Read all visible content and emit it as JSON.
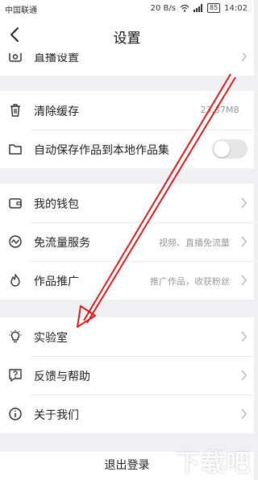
{
  "status_bar": {
    "carrier": "中国联通",
    "speed": "20 B/s",
    "battery": "85",
    "time": "14:02"
  },
  "nav": {
    "title": "设置"
  },
  "rows": {
    "live_settings": "直播设置",
    "clear_cache": "清除缓存",
    "cache_size": "23.37MB",
    "auto_save": "自动保存作品到本地作品集",
    "wallet": "我的钱包",
    "free_data": "免流量服务",
    "free_data_desc": "视频、直播免流量",
    "promotion": "作品推广",
    "promotion_desc": "推广作品，收获粉丝",
    "lab": "实验室",
    "feedback": "反馈与帮助",
    "about": "关于我们"
  },
  "logout": "退出登录",
  "auto_save_enabled": false,
  "annotation_color": "#cc2020",
  "icons": [
    "back-arrow-icon",
    "camera-icon",
    "trash-icon",
    "folder-icon",
    "wallet-icon",
    "pulse-icon",
    "flame-icon",
    "lightbulb-icon",
    "question-icon",
    "info-icon",
    "chevron-right-icon",
    "wifi-icon",
    "signal-icon",
    "battery-icon"
  ]
}
